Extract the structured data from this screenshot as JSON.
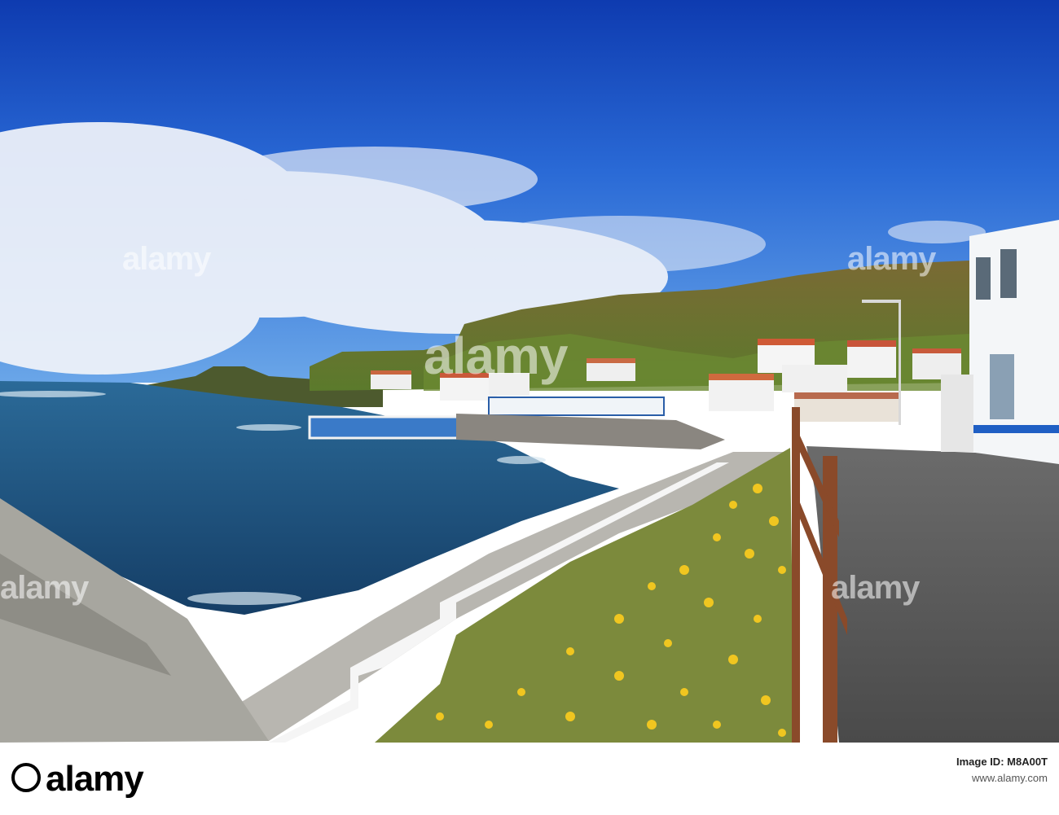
{
  "watermark": {
    "brand": "alamy",
    "repeat_text": "alamy"
  },
  "footer": {
    "logo": "alamy",
    "image_id_label": "Image ID: M8A00T",
    "site": "www.alamy.com"
  },
  "colors": {
    "sky_top": "#1446b8",
    "sky_mid": "#2a6ed8",
    "sea": "#1e4f7e",
    "hill": "#8a7a3a",
    "flowers": "#e9c42a"
  }
}
